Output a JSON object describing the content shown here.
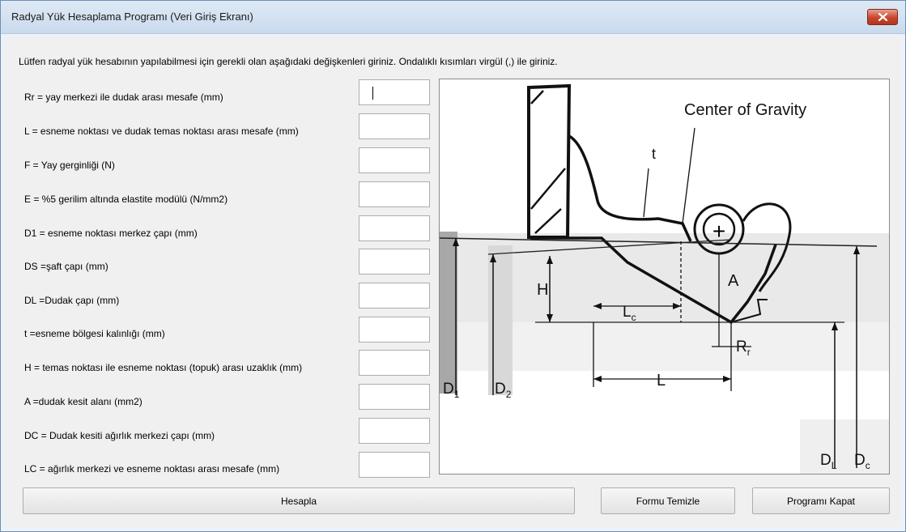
{
  "window": {
    "title": "Radyal Yük Hesaplama Programı (Veri Giriş Ekranı)"
  },
  "instructions": "Lütfen radyal yük hesabının yapılabilmesi için gerekli olan aşağıdaki değişkenleri giriniz. Ondalıklı kısımları virgül (,) ile giriniz.",
  "fields": [
    {
      "label": "Rr = yay merkezi ile dudak arası mesafe (mm)",
      "value": ""
    },
    {
      "label": "L = esneme noktası ve dudak temas noktası arası mesafe (mm)",
      "value": ""
    },
    {
      "label": "F = Yay  gerginliği (N)",
      "value": ""
    },
    {
      "label": "E = %5 gerilim altında elastite modülü (N/mm2)",
      "value": ""
    },
    {
      "label": "D1 = esneme noktası merkez çapı (mm)",
      "value": ""
    },
    {
      "label": "DS =şaft çapı (mm)",
      "value": ""
    },
    {
      "label": "DL =Dudak çapı (mm)",
      "value": ""
    },
    {
      "label": "t =esneme bölgesi kalınlığı (mm)",
      "value": ""
    },
    {
      "label": "H = temas noktası ile esneme noktası (topuk) arası uzaklık (mm)",
      "value": ""
    },
    {
      "label": "A =dudak kesit alanı (mm2)",
      "value": ""
    },
    {
      "label": "DC = Dudak kesiti ağırlık merkezi çapı (mm)",
      "value": ""
    },
    {
      "label": "LC = ağırlık merkezi ve esneme noktası arası mesafe (mm)",
      "value": ""
    }
  ],
  "diagram": {
    "title": "Center of Gravity",
    "labels": {
      "t": "t",
      "H": "H",
      "A": "A",
      "Lc": "L",
      "Lc_sub": "c",
      "Rr": "R",
      "Rr_sub": "r",
      "L": "L",
      "D1": "D",
      "D1_sub": "1",
      "D2": "D",
      "D2_sub": "2",
      "DL": "D",
      "DL_sub": "L",
      "Dc": "D",
      "Dc_sub": "c",
      "plus": "+"
    }
  },
  "buttons": {
    "calculate": "Hesapla",
    "clear": "Formu Temizle",
    "close": "Programı Kapat"
  }
}
